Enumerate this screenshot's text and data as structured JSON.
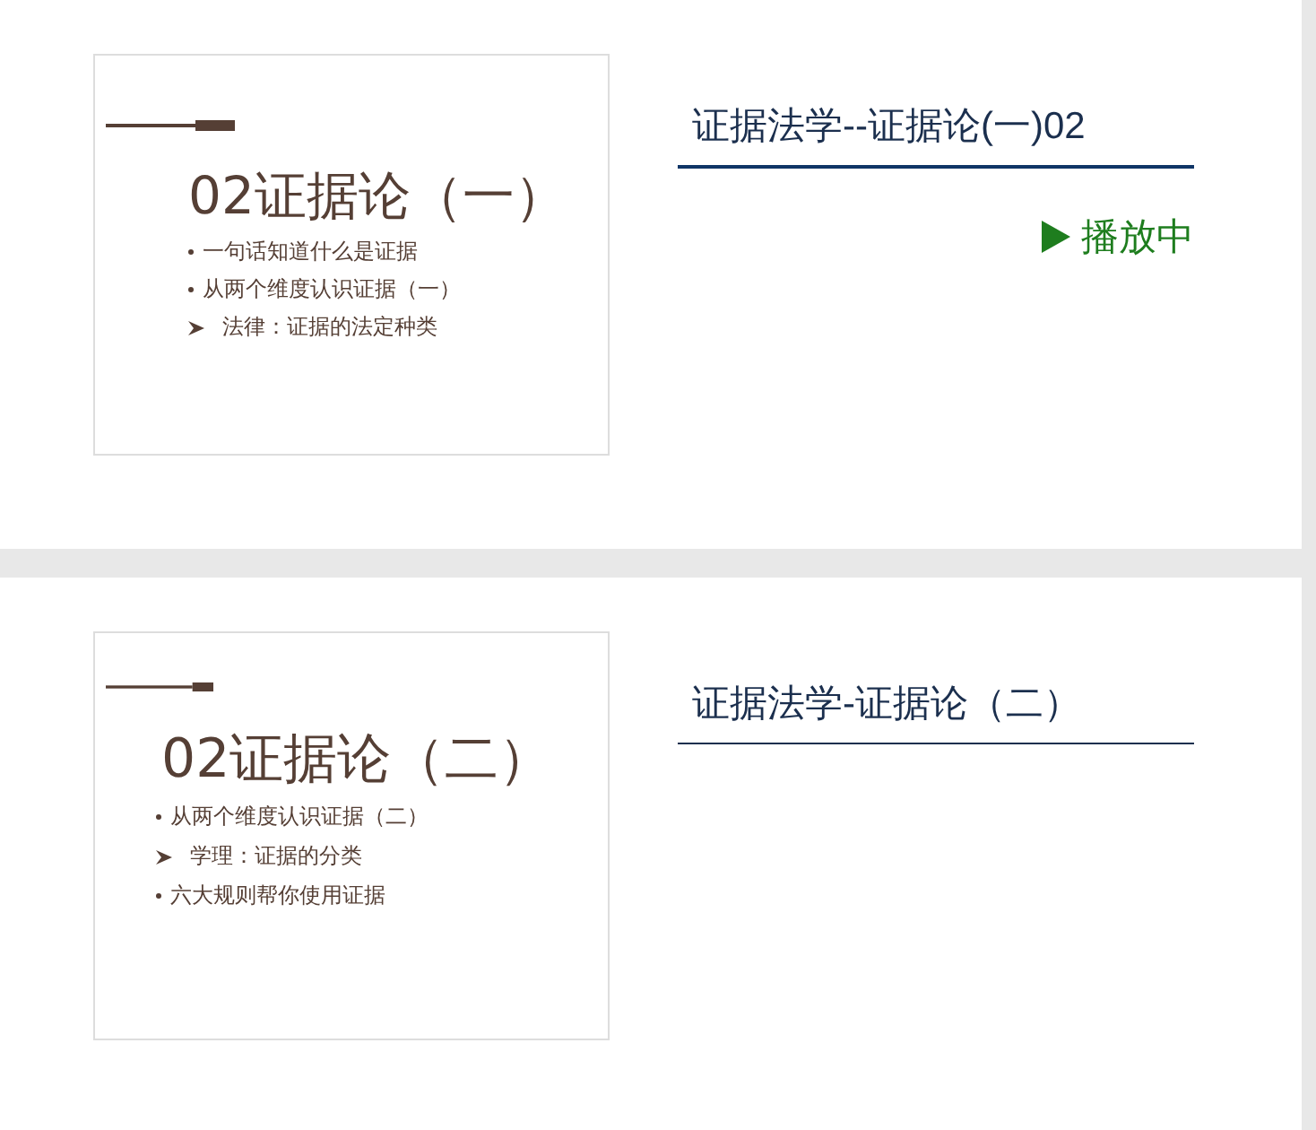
{
  "lessons": [
    {
      "slide": {
        "title": "02证据论（一）",
        "points": [
          {
            "kind": "bullet",
            "text": "一句话知道什么是证据"
          },
          {
            "kind": "bullet",
            "text": "从两个维度认识证据（一）"
          },
          {
            "kind": "arrow",
            "text": "法律：证据的法定种类"
          }
        ]
      },
      "title": "证据法学--证据论(一)02",
      "selected": true,
      "status": "播放中"
    },
    {
      "slide": {
        "title": "02证据论（二）",
        "points": [
          {
            "kind": "bullet",
            "text": "从两个维度认识证据（二）"
          },
          {
            "kind": "arrow",
            "text": "学理：证据的分类"
          },
          {
            "kind": "bullet",
            "text": "六大规则帮你使用证据"
          }
        ]
      },
      "title": "证据法学-证据论（二）",
      "selected": false
    }
  ]
}
